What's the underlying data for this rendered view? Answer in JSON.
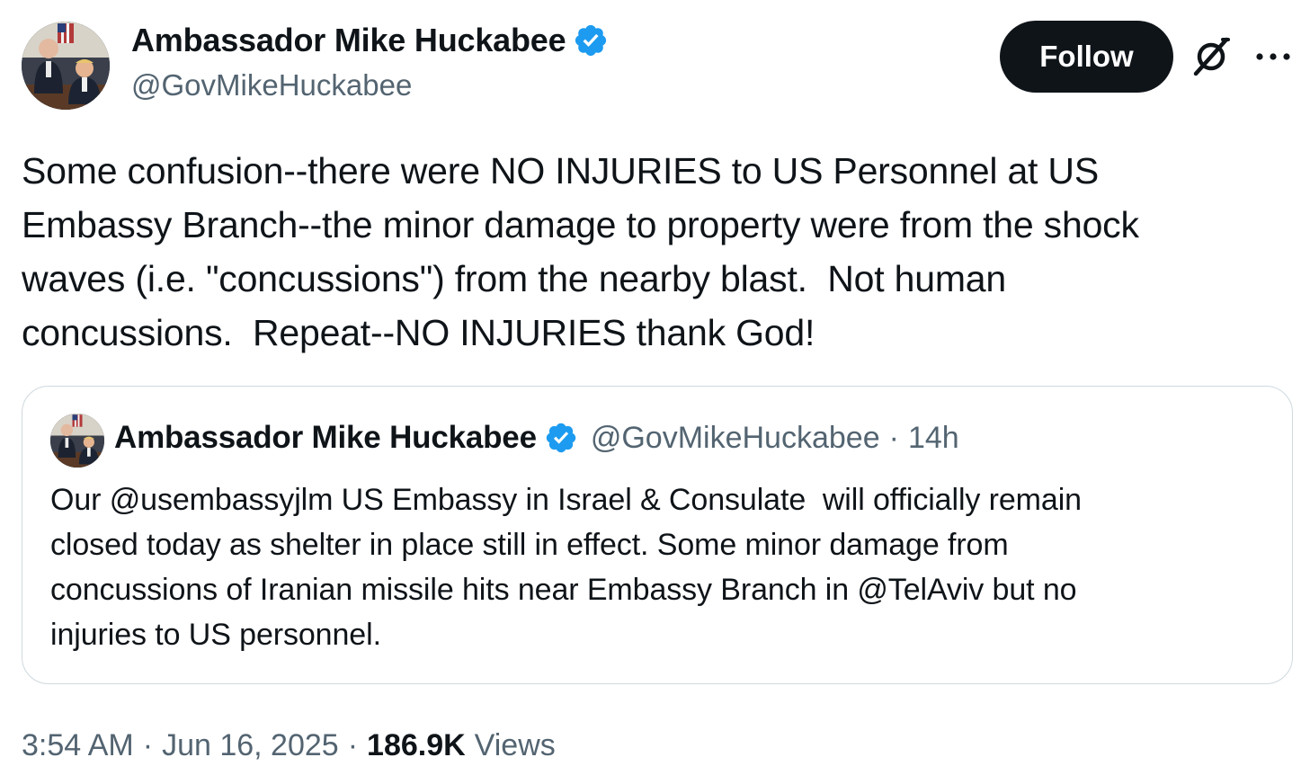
{
  "author": {
    "display_name": "Ambassador Mike Huckabee",
    "handle": "@GovMikeHuckabee",
    "verified": true
  },
  "actions": {
    "follow_label": "Follow"
  },
  "tweet": {
    "text": "Some confusion--there were NO INJURIES to US Personnel at US\nEmbassy Branch--the minor damage to property were from the shock\nwaves (i.e. \"concussions\") from the nearby blast.  Not human\nconcussions.  Repeat--NO INJURIES thank God!"
  },
  "quoted_tweet": {
    "display_name": "Ambassador Mike Huckabee",
    "handle": "@GovMikeHuckabee",
    "dot": "·",
    "time": "14h",
    "text": "Our @usembassyjlm US Embassy in Israel & Consulate  will officially remain\nclosed today as shelter in place still in effect. Some minor damage from\nconcussions of Iranian missile hits near Embassy Branch in @TelAviv but no\ninjuries to US personnel."
  },
  "meta": {
    "time": "3:54 AM",
    "date": "Jun 16, 2025",
    "separator": "·",
    "views_count": "186.9K",
    "views_label": "Views"
  },
  "colors": {
    "verified": "#1d9bf0",
    "text": "#0f1419",
    "secondary": "#536471",
    "border": "#cfd9de",
    "follow_bg": "#0f1419"
  },
  "icons": [
    "verified-badge-icon",
    "grok-icon",
    "more-options-icon"
  ]
}
